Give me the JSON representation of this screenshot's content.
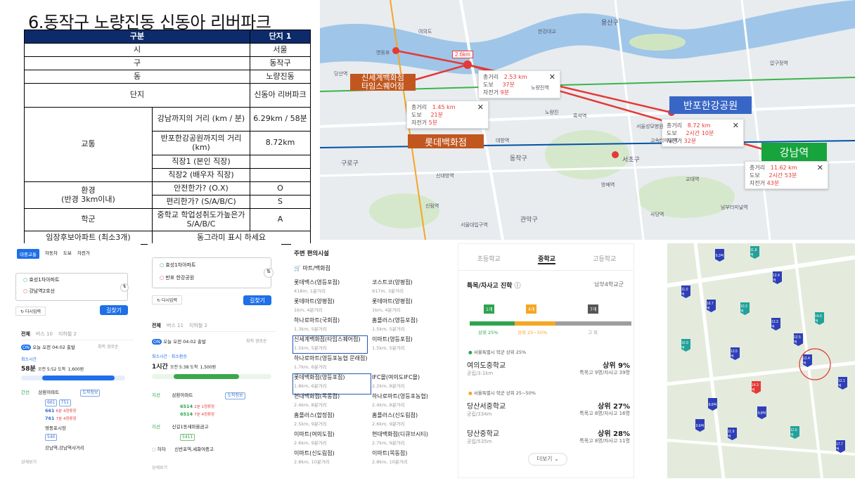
{
  "title": "6.동작구 노량진동 신동아 리버파크",
  "table": {
    "header": {
      "category": "구분",
      "complex": "단지 1"
    },
    "rows": {
      "city": {
        "label": "시",
        "value": "서울"
      },
      "gu": {
        "label": "구",
        "value": "동작구"
      },
      "dong": {
        "label": "동",
        "value": "노량진동"
      },
      "complex": {
        "label": "단지",
        "value": "신동아 리버파크"
      },
      "transport": {
        "label": "교통",
        "gangnam": {
          "label": "강남까지의 거리 (km / 분)",
          "value": "6.29km / 58분"
        },
        "banpo": {
          "label": "반포한강공원까지의 거리 (km)",
          "value": "8.72km"
        },
        "work1": {
          "label": "직장1 (본인 직장)",
          "value": ""
        },
        "work2": {
          "label": "직장2 (배우자 직장)",
          "value": ""
        }
      },
      "environment": {
        "label": "환경",
        "label2": "(반경 3km이내)",
        "safe": {
          "label": "안전한가? (O.X)",
          "value": "O"
        },
        "convenient": {
          "label": "편리한가? (S/A/B/C)",
          "value": "S"
        }
      },
      "school": {
        "label": "학군",
        "sublabel": "중학교 학업성취도가높은가 S/A/B/C",
        "value": "A"
      },
      "future": {
        "label": "임장후보아파트 (최소3개)",
        "value": "동그라미 표시 하세요"
      }
    }
  },
  "map_top": {
    "distance_badge": "2.6km",
    "labels": {
      "shinsegae": "신세계백화점\n타임스퀘어점",
      "lotte": "롯데백화점",
      "banpo": "반포한강공원",
      "gangnam": "강남역"
    },
    "popups": [
      {
        "total": "2.53 km",
        "walk": "37분",
        "bike": "9분"
      },
      {
        "total": "1.45 km",
        "walk": "21분",
        "bike": "5분"
      },
      {
        "total": "8.72 km",
        "walk": "2시간 10분",
        "bike": "32분"
      },
      {
        "total": "11.62 km",
        "walk": "2시간 53분",
        "bike": "43분"
      }
    ],
    "popup_labels": {
      "total": "총거리",
      "walk": "도보",
      "bike": "자전거"
    },
    "place_names": [
      "한강대교",
      "노량진역",
      "대방역",
      "노량진",
      "동작구",
      "흑석역",
      "서울성모병원",
      "고속터미널역",
      "서초구",
      "교대역",
      "방배역",
      "관악구",
      "구로구",
      "여의도",
      "영등포",
      "용산구",
      "남부터미널역",
      "서울대입구역",
      "사당역",
      "신림역",
      "신대방역",
      "당산역",
      "압구정역"
    ]
  },
  "route1": {
    "modes": [
      "대중교통",
      "자동차",
      "도보",
      "자전거"
    ],
    "from": "효성1차아파트",
    "to": "강남역2호선",
    "add_stop": "다시입력",
    "search": "길찾기",
    "tabs": [
      "전체",
      "버스 10",
      "지하철 2"
    ],
    "depart": "오늘 오전 04:02 출발",
    "sort": "최적 경로순",
    "best_label": "최소시간",
    "duration": "58분",
    "arrive": "오전 5:52 도착",
    "fare": "1,600원",
    "steps": [
      {
        "type": "간선",
        "name": "삼환아파트",
        "badge": "도착정보"
      },
      {
        "type": "",
        "name": "661",
        "detail": "6분 4정류장"
      },
      {
        "type": "",
        "name": "761",
        "detail": "7분 4정류장"
      },
      {
        "type": "",
        "name": "영등포시장",
        "badge": ""
      },
      {
        "type": "",
        "name": "강남역,강남역사거리",
        "badge": ""
      }
    ],
    "more": "상세보기"
  },
  "route2": {
    "from": "효성1차아파트",
    "to": "반포 한강공원",
    "add_stop": "다시입력",
    "search": "길찾기",
    "tabs": [
      "전체",
      "버스 11",
      "지하철 2"
    ],
    "depart": "오늘 오전 04:02 출발",
    "sort": "최적 경로순",
    "best_label": "최소시간 · 최소환승",
    "duration": "1시간",
    "arrive": "오전 5:38 도착",
    "fare": "1,500원",
    "steps": [
      {
        "type": "지선",
        "name": "삼환아파트",
        "badge": "도착정보"
      },
      {
        "type": "",
        "name": "6514",
        "detail": "2분 1정류장"
      },
      {
        "type": "",
        "name": "6514",
        "detail": "7분 4정류장"
      },
      {
        "type": "지선",
        "name": "신길1동새마을금고",
        "badge": ""
      },
      {
        "type": "",
        "name": "5411",
        "detail": ""
      },
      {
        "type": "",
        "name": "신반포역,세화여중고",
        "badge": ""
      }
    ],
    "end_label": "하차",
    "more": "상세보기"
  },
  "facilities": {
    "title": "주변 편의시설",
    "category": "마트/백화점",
    "items": [
      {
        "name": "롯데백스(영등포점)",
        "sub": "418m, 1분거리"
      },
      {
        "name": "코스트코(양평점)",
        "sub": "917m, 3분거리"
      },
      {
        "name": "롯데마트(양평점)",
        "sub": "1km, 4분거리"
      },
      {
        "name": "롯데마트(양평점)",
        "sub": "1km, 4분거리"
      },
      {
        "name": "하나로마트(국회점)",
        "sub": "1.3km, 5분거리"
      },
      {
        "name": "홈플러스(영등포점)",
        "sub": "1.5km, 5분거리"
      },
      {
        "name": "신세계백화점(타임스퀘어점)",
        "sub": "1.5km, 5분거리"
      },
      {
        "name": "이마트(영등포점)",
        "sub": "1.5km, 5분거리"
      },
      {
        "name": "하나로마트(영등포농협 문래점)",
        "sub": "1.7km, 6분거리"
      },
      {
        "name": "",
        "sub": ""
      },
      {
        "name": "롯데백화점(영등포점)",
        "sub": "1.8km, 6분거리"
      },
      {
        "name": "IFC몰(여의도IFC몰)",
        "sub": "2.2km, 8분거리"
      },
      {
        "name": "현대백화점(목동점)",
        "sub": "2.4km, 8분거리"
      },
      {
        "name": "하나로마트(영등포농협)",
        "sub": "2.4km, 8분거리"
      },
      {
        "name": "홈플러스(합정점)",
        "sub": "2.5km, 9분거리"
      },
      {
        "name": "홈플러스(신도림점)",
        "sub": "2.6km, 9분거리"
      },
      {
        "name": "이마트(여의도점)",
        "sub": "2.6km, 9분거리"
      },
      {
        "name": "현대백화점(디큐브시티)",
        "sub": "2.7km, 9분거리"
      },
      {
        "name": "이마트(신도림점)",
        "sub": "2.8km, 10분거리"
      },
      {
        "name": "이마트(목동점)",
        "sub": "2.8km, 10분거리"
      }
    ]
  },
  "schools": {
    "tabs": [
      "초등학교",
      "중학교",
      "고등학교"
    ],
    "active_tab": "중학교",
    "section": "특목/자사고 진학",
    "district": "남부4학교군",
    "flags": [
      "1개",
      "4개",
      "7개"
    ],
    "bar_labels": [
      "상위 25%",
      "상위 25~50%",
      "그 외"
    ],
    "legend1": "서울특별시 학군 상위 25%",
    "legend2": "서울특별시 학군 상위 25~50%",
    "list": [
      {
        "name": "여의도중학교",
        "sub": "공립/3.1km",
        "rank": "상위 9%",
        "detail": "특목고 9명/자사고 39명"
      },
      {
        "name": "당산서중학교",
        "sub": "공립/334m",
        "rank": "상위 27%",
        "detail": "특목고 8명/자사고 16명"
      },
      {
        "name": "당산중학교",
        "sub": "공립/535m",
        "rank": "상위 28%",
        "detail": "특목고 8명/자사고 11명"
      }
    ],
    "more": "더보기"
  },
  "apt_map": {
    "pins": [
      "8.3억",
      "11.8억",
      "12.4억",
      "14.3억",
      "12.5억",
      "10.9억",
      "9.6억",
      "13.5억",
      "8.8억",
      "12.5억",
      "11.9억",
      "12.4억",
      "13.3억",
      "10.3억",
      "11.0억",
      "9.8억",
      "17.7억",
      "14.6억",
      "16.7억",
      "12.1억"
    ],
    "highlight": "14.3억"
  },
  "colors": {
    "table_header": "#0d2b6b",
    "label_orange": "#c1571f",
    "label_blue": "#3866c6",
    "label_green": "#17a43c",
    "route_red": "#e53935",
    "naver_blue": "#1e6fe8"
  }
}
